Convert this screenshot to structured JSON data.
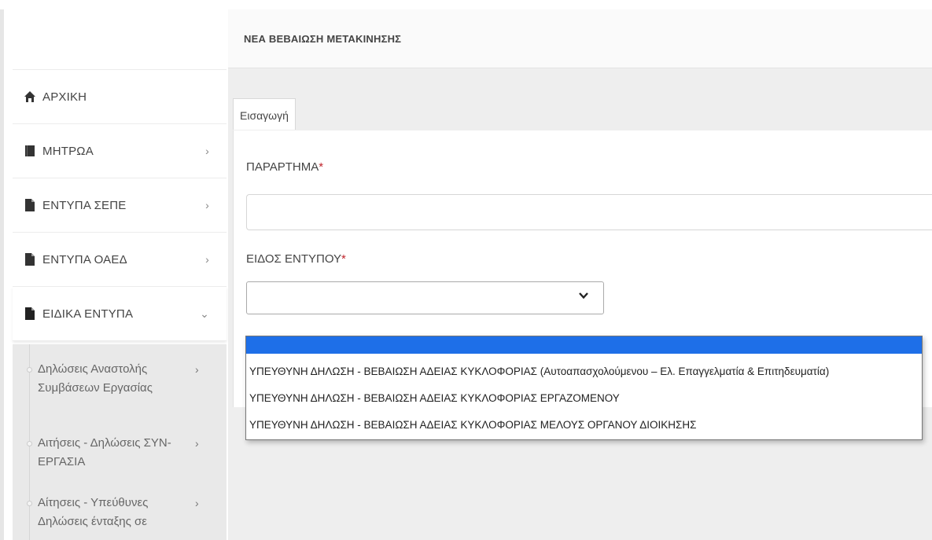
{
  "header": {
    "title": "ΝΕΑ ΒΕΒΑΙΩΣΗ ΜΕΤΑΚΙΝΗΣΗΣ"
  },
  "sidebar": {
    "items": [
      {
        "label": "ΑΡΧΙΚΗ",
        "icon": "home-icon"
      },
      {
        "label": "ΜΗΤΡΩΑ",
        "icon": "book-icon",
        "chevron": "›"
      },
      {
        "label": "ΕΝΤΥΠΑ ΣΕΠΕ",
        "icon": "file-icon",
        "chevron": "›"
      },
      {
        "label": "ΕΝΤΥΠΑ ΟΑΕΔ",
        "icon": "file-icon",
        "chevron": "›"
      },
      {
        "label": "ΕΙΔΙΚΑ ΕΝΤΥΠΑ",
        "icon": "file-icon",
        "chevron": "⌄"
      }
    ],
    "subitems": [
      {
        "line1": "Δηλώσεις Αναστολής",
        "line2": "Συμβάσεων Εργασίας",
        "chevron": "›"
      },
      {
        "line1": "Αιτήσεις - Δηλώσεις ΣΥΝ-",
        "line2": "ΕΡΓΑΣΙΑ",
        "chevron": "›"
      },
      {
        "line1": "Αίτησεις - Υπεύθυνες",
        "line2": "Δηλώσεις ένταξης σε",
        "chevron": "›"
      }
    ]
  },
  "form": {
    "tab_label": "Εισαγωγή",
    "field1_label": "ΠΑΡΑΡΤΗΜΑ",
    "field2_label": "ΕΙΔΟΣ ΕΝΤΥΠΟΥ",
    "required_mark": "*",
    "select_value": ""
  },
  "dropdown": {
    "options": [
      "",
      "ΥΠΕΥΘΥΝΗ ΔΗΛΩΣΗ - ΒΕΒΑΙΩΣΗ ΑΔΕΙΑΣ ΚΥΚΛΟΦΟΡΙΑΣ (Αυτοαπασχολούμενου – Ελ. Επαγγελματία & Επιτηδευματία)",
      "ΥΠΕΥΘΥΝΗ ΔΗΛΩΣΗ - ΒΕΒΑΙΩΣΗ ΑΔΕΙΑΣ ΚΥΚΛΟΦΟΡΙΑΣ ΕΡΓΑΖΟΜΕΝΟΥ",
      "ΥΠΕΥΘΥΝΗ ΔΗΛΩΣΗ - ΒΕΒΑΙΩΣΗ ΑΔΕΙΑΣ ΚΥΚΛΟΦΟΡΙΑΣ ΜΕΛΟΥΣ ΟΡΓΑΝΟΥ ΔΙΟΙΚΗΣΗΣ"
    ]
  },
  "colors": {
    "selected_option": "#1e6fe8",
    "required": "#c0262d",
    "main_bg": "#eeeeee",
    "submenu_bg": "#e9e9e9"
  }
}
